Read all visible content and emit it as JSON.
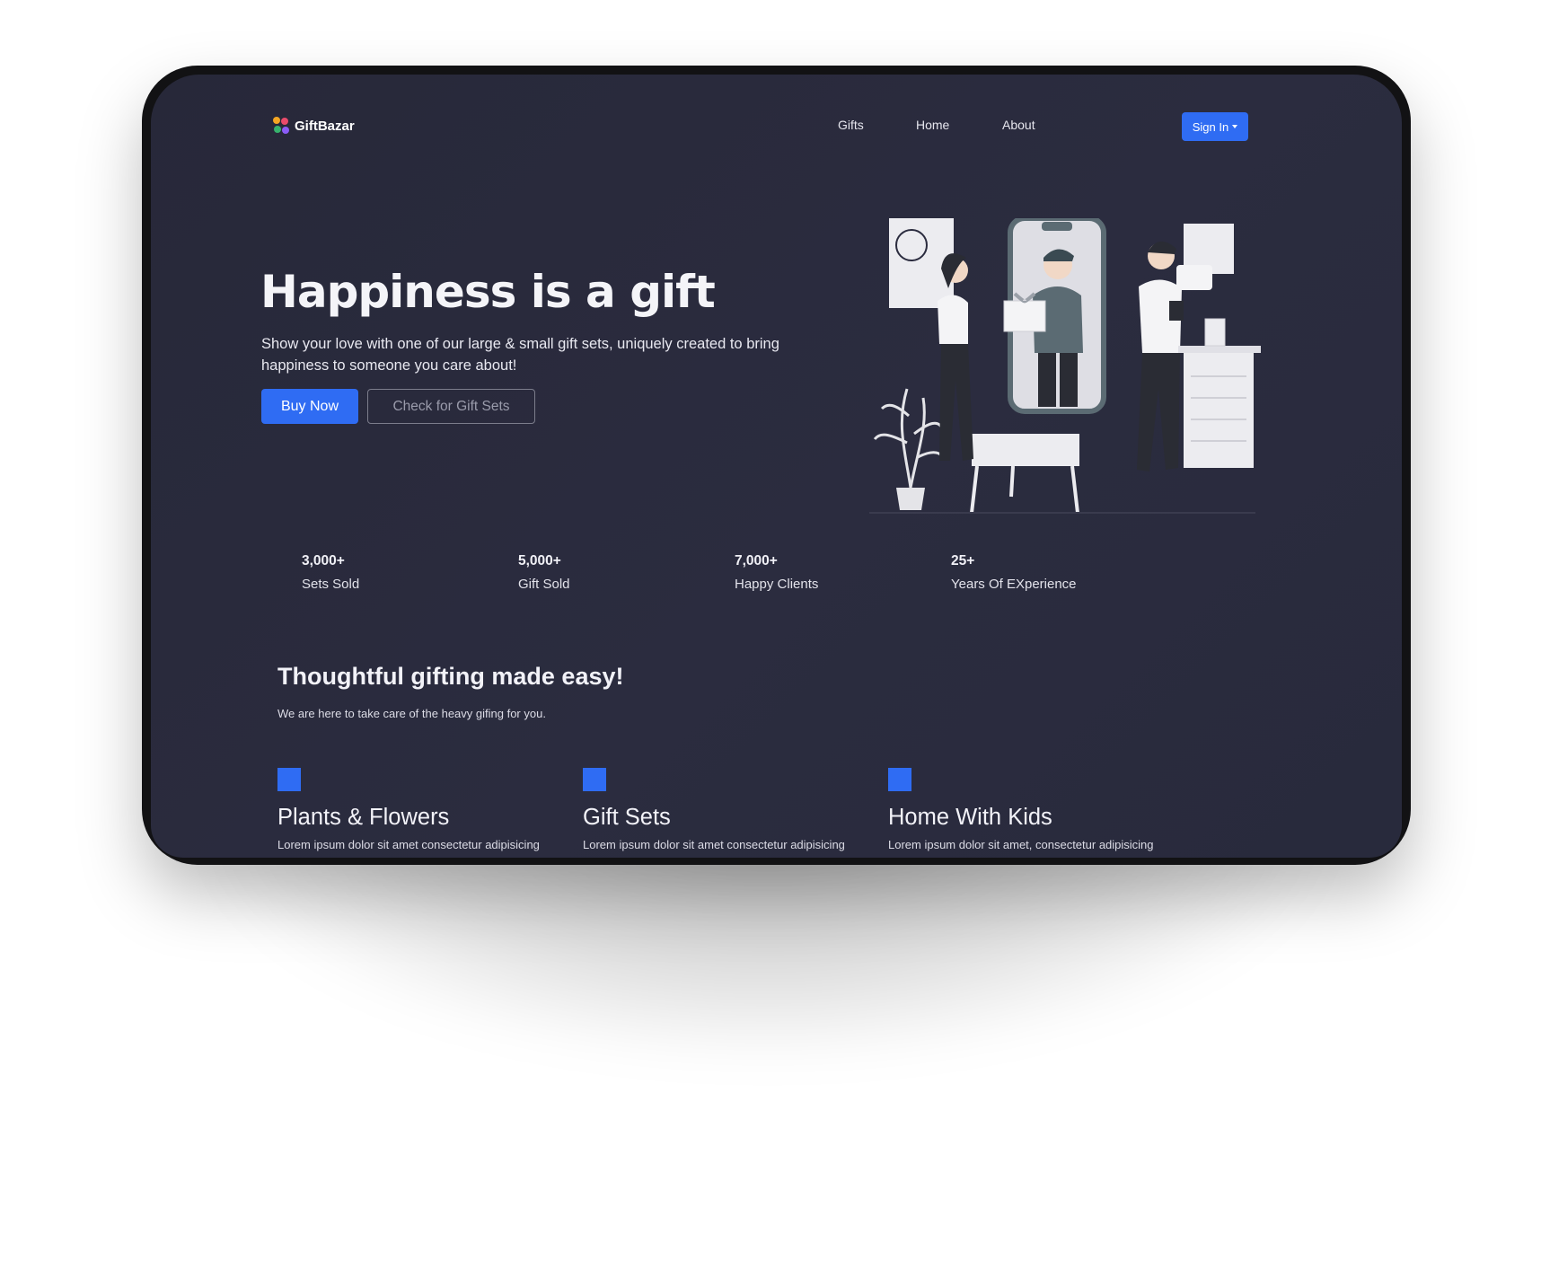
{
  "brand": {
    "name": "GiftBazar",
    "accent": "#2f6cf3"
  },
  "nav": {
    "links": [
      "Gifts",
      "Home",
      "About"
    ],
    "signin_label": "Sign In"
  },
  "hero": {
    "title": "Happiness is a gift",
    "subtitle": "Show your love with one of our large & small gift sets, uniquely created to bring happiness to someone you care about!",
    "primary_button": "Buy Now",
    "secondary_button": "Check for Gift Sets",
    "illustration_icon": "gift-giving-illustration"
  },
  "stats": [
    {
      "value": "3,000+",
      "label": "Sets Sold"
    },
    {
      "value": "5,000+",
      "label": "Gift Sold"
    },
    {
      "value": "7,000+",
      "label": "Happy Clients"
    },
    {
      "value": "25+",
      "label": "Years Of EXperience"
    }
  ],
  "section": {
    "title": "Thoughtful gifting made easy!",
    "subtitle": "We are here to take care of the heavy gifing for you."
  },
  "cards": [
    {
      "title": "Plants & Flowers",
      "text": "Lorem ipsum dolor sit amet consectetur adipisicing"
    },
    {
      "title": "Gift Sets",
      "text": "Lorem ipsum dolor sit amet consectetur adipisicing"
    },
    {
      "title": "Home With Kids",
      "text": "Lorem ipsum dolor sit amet, consectetur adipisicing"
    }
  ]
}
